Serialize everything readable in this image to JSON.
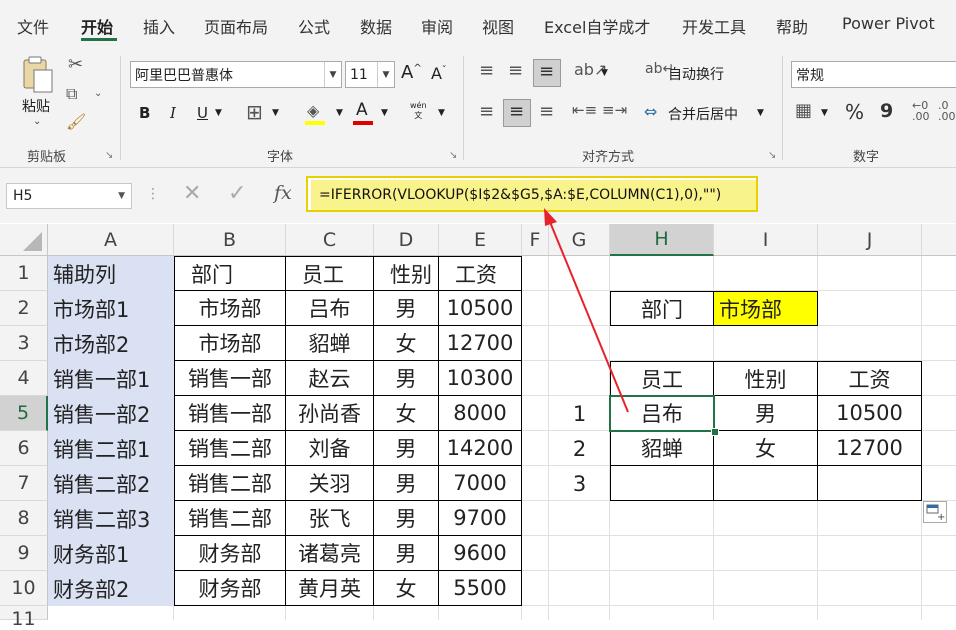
{
  "menu": {
    "items": [
      "文件",
      "开始",
      "插入",
      "页面布局",
      "公式",
      "数据",
      "审阅",
      "视图",
      "Excel自学成才",
      "开发工具",
      "帮助",
      "Power Pivot"
    ],
    "active": "开始"
  },
  "ribbon": {
    "clipboard": {
      "paste_label": "粘贴",
      "group_label": "剪贴板"
    },
    "font": {
      "font_name": "阿里巴巴普惠体",
      "font_size": "11",
      "group_label": "字体",
      "bold": "B",
      "italic": "I",
      "underline": "U",
      "phonetic": "wén\n文"
    },
    "alignment": {
      "wrap_text": "自动换行",
      "merge_center": "合并后居中",
      "group_label": "对齐方式"
    },
    "number": {
      "format": "常规",
      "percent": "%",
      "comma": "9",
      "group_label": "数字"
    }
  },
  "formula_bar": {
    "name_box": "H5",
    "fx": "fx",
    "formula": "=IFERROR(VLOOKUP($I$2&$G5,$A:$E,COLUMN(C1),0),\"\")"
  },
  "sheet": {
    "columns": [
      "A",
      "B",
      "C",
      "D",
      "E",
      "F",
      "G",
      "H",
      "I",
      "J"
    ],
    "rows": [
      "1",
      "2",
      "3",
      "4",
      "5",
      "6",
      "7",
      "8",
      "9",
      "10",
      "11"
    ],
    "selected_cell": "H5",
    "table_left": {
      "headers": [
        "辅助列",
        "部门",
        "员工",
        "性别",
        "工资"
      ],
      "rows": [
        [
          "市场部1",
          "市场部",
          "吕布",
          "男",
          "10500"
        ],
        [
          "市场部2",
          "市场部",
          "貂蝉",
          "女",
          "12700"
        ],
        [
          "销售一部1",
          "销售一部",
          "赵云",
          "男",
          "10300"
        ],
        [
          "销售一部2",
          "销售一部",
          "孙尚香",
          "女",
          "8000"
        ],
        [
          "销售二部1",
          "销售二部",
          "刘备",
          "男",
          "14200"
        ],
        [
          "销售二部2",
          "销售二部",
          "关羽",
          "男",
          "7000"
        ],
        [
          "销售二部3",
          "销售二部",
          "张飞",
          "男",
          "9700"
        ],
        [
          "财务部1",
          "财务部",
          "诸葛亮",
          "男",
          "9600"
        ],
        [
          "财务部2",
          "财务部",
          "黄月英",
          "女",
          "5500"
        ]
      ]
    },
    "lookup": {
      "dept_label": "部门",
      "dept_value": "市场部",
      "headers": [
        "员工",
        "性别",
        "工资"
      ],
      "index": [
        "1",
        "2",
        "3"
      ],
      "results": [
        [
          "吕布",
          "男",
          "10500"
        ],
        [
          "貂蝉",
          "女",
          "12700"
        ],
        [
          "",
          "",
          ""
        ]
      ]
    }
  },
  "colors": {
    "accent": "#217346",
    "helper_column_fill": "#d9e1f2",
    "dept_value_fill": "#ffff00",
    "formula_highlight": "#f8f38a",
    "arrow": "#e8222b"
  }
}
